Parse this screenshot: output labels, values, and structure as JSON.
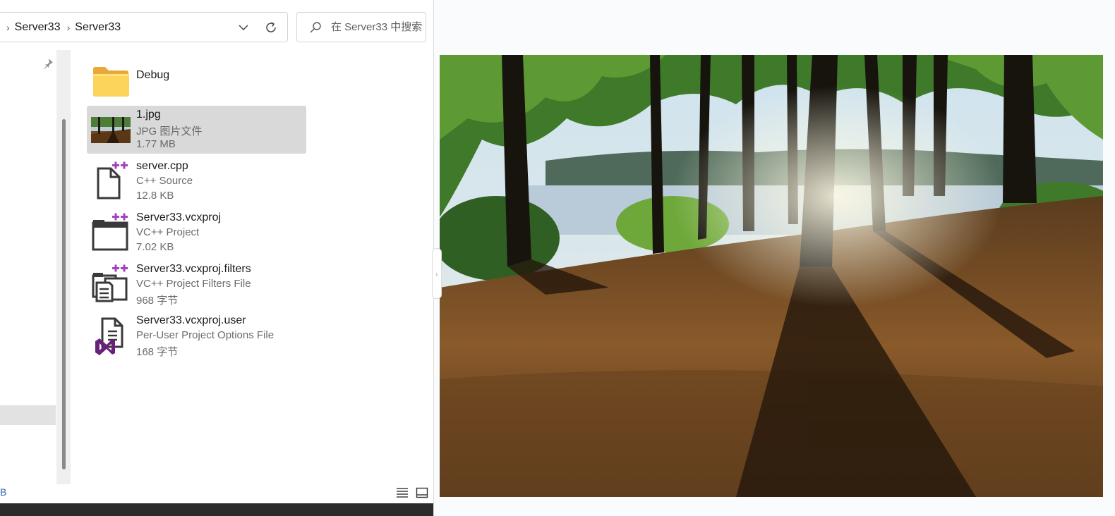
{
  "address_bar": {
    "breadcrumbs": [
      "Server33",
      "Server33"
    ]
  },
  "search": {
    "placeholder": "在 Server33 中搜索"
  },
  "files": [
    {
      "name": "Debug",
      "type": "",
      "size": "",
      "icon": "folder-icon"
    },
    {
      "name": "1.jpg",
      "type": "JPG 图片文件",
      "size": "1.77 MB",
      "icon": "image-thumbnail",
      "selected": true
    },
    {
      "name": "server.cpp",
      "type": "C++ Source",
      "size": "12.8 KB",
      "icon": "cpp-file-icon"
    },
    {
      "name": "Server33.vcxproj",
      "type": "VC++ Project",
      "size": "7.02 KB",
      "icon": "vcxproj-icon"
    },
    {
      "name": "Server33.vcxproj.filters",
      "type": "VC++ Project Filters File",
      "size": "968 字节",
      "icon": "vcxproj-filters-icon"
    },
    {
      "name": "Server33.vcxproj.user",
      "type": "Per-User Project Options File",
      "size": "168 字节",
      "icon": "vcxproj-user-icon"
    }
  ],
  "status_bar": {
    "partial_text": "B"
  },
  "colors": {
    "selection": "#d9d9d9",
    "folder": "#f7c948",
    "vs_purple": "#68217a",
    "plus_purple": "#b04fc8"
  }
}
